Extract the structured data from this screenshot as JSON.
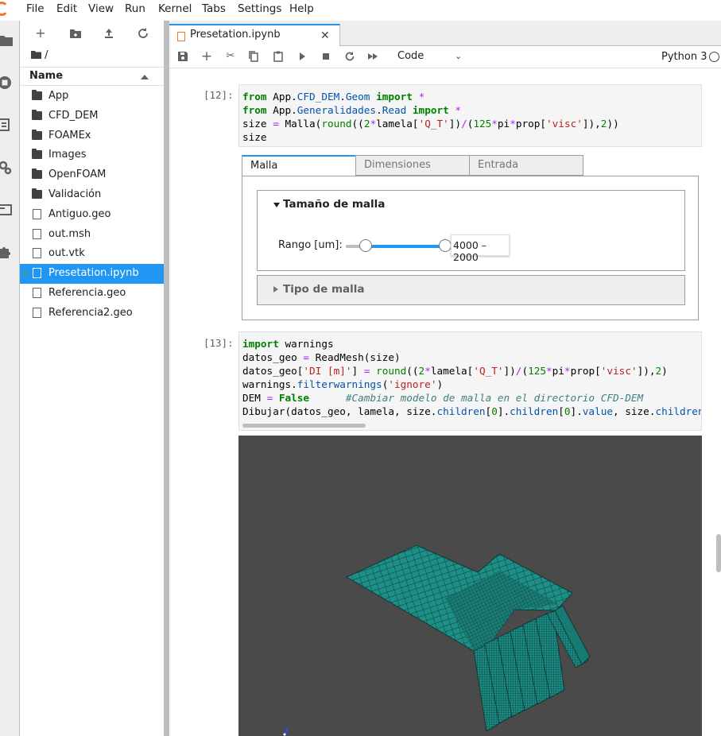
{
  "menu": [
    "File",
    "Edit",
    "View",
    "Run",
    "Kernel",
    "Tabs",
    "Settings",
    "Help"
  ],
  "file_browser": {
    "breadcrumb": "/",
    "header_name": "Name",
    "items": [
      {
        "label": "App",
        "type": "folder"
      },
      {
        "label": "CFD_DEM",
        "type": "folder"
      },
      {
        "label": "FOAMEx",
        "type": "folder"
      },
      {
        "label": "Images",
        "type": "folder"
      },
      {
        "label": "OpenFOAM",
        "type": "folder"
      },
      {
        "label": "Validación",
        "type": "folder"
      },
      {
        "label": "Antiguo.geo",
        "type": "file"
      },
      {
        "label": "out.msh",
        "type": "file"
      },
      {
        "label": "out.vtk",
        "type": "file"
      },
      {
        "label": "Presetation.ipynb",
        "type": "notebook",
        "selected": true
      },
      {
        "label": "Referencia.geo",
        "type": "file"
      },
      {
        "label": "Referencia2.geo",
        "type": "file"
      }
    ]
  },
  "tab": {
    "title": "Presetation.ipynb"
  },
  "toolbar": {
    "cell_type": "Code",
    "kernel": "Python 3"
  },
  "cells": [
    {
      "prompt": "[12]:"
    },
    {
      "prompt": "[13]:"
    }
  ],
  "widget": {
    "tabs": [
      "Malla",
      "Dimensiones",
      "Entrada"
    ],
    "section_title": "Tamaño de malla",
    "range_label": "Rango [um]:",
    "range_value": "4000 – 2000",
    "range_fill_start": 0.2,
    "range_fill_end": 1.0,
    "collapsed_section": "Tipo de malla"
  },
  "colors": {
    "accent": "#2196f3",
    "mesh": "#1e8f86",
    "viewer_bg": "#4a4a4a"
  }
}
